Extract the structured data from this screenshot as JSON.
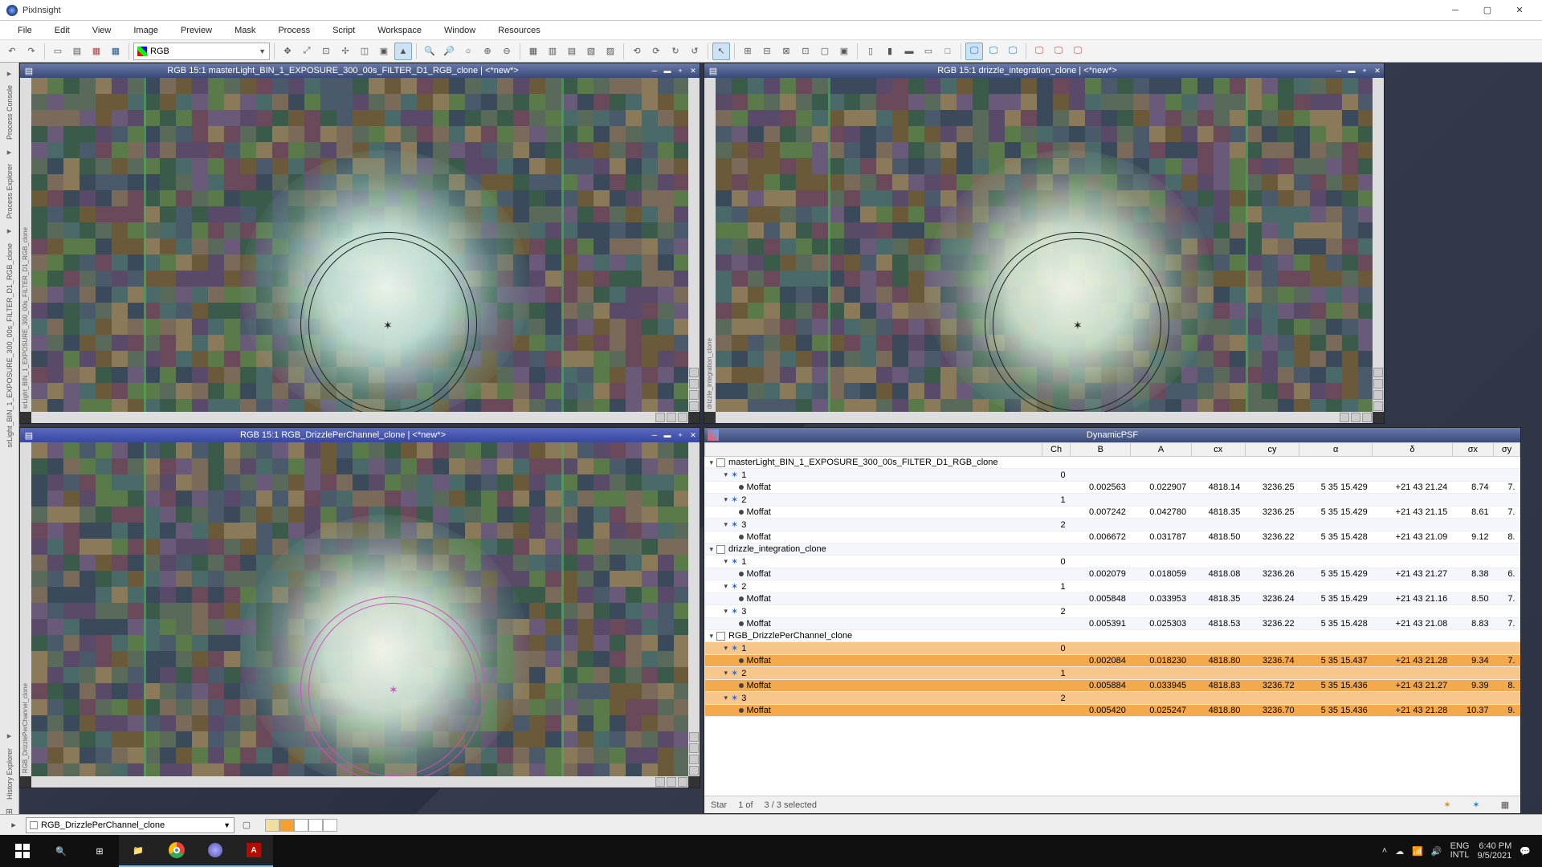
{
  "app": {
    "title": "PixInsight"
  },
  "menu": [
    "File",
    "Edit",
    "View",
    "Image",
    "Preview",
    "Mask",
    "Process",
    "Script",
    "Workspace",
    "Window",
    "Resources"
  ],
  "toolbar_select": {
    "label": "RGB"
  },
  "left_rail": [
    "Process Console",
    "Process Explorer",
    "srLight_BIN_1_EXPOSURE_300_00s_FILTER_D1_RGB_clone",
    "History Explorer"
  ],
  "windows": {
    "tl": {
      "title": "RGB 15:1 masterLight_BIN_1_EXPOSURE_300_00s_FILTER_D1_RGB_clone | <*new*>",
      "vlabel": "srLight_BIN_1_EXPOSURE_300_00s_FILTER_D1_RGB_clone"
    },
    "tr": {
      "title": "RGB 15:1 drizzle_integration_clone | <*new*>",
      "vlabel": "drizzle_integration_clone"
    },
    "bl": {
      "title": "RGB 15:1 RGB_DrizzlePerChannel_clone | <*new*>",
      "vlabel": "RGB_DrizzlePerChannel_clone"
    },
    "psf": {
      "title": "DynamicPSF"
    }
  },
  "psf": {
    "columns": [
      "",
      "Ch",
      "B",
      "A",
      "cx",
      "cy",
      "α",
      "δ",
      "σx",
      "σy"
    ],
    "groups": [
      {
        "name": "masterLight_BIN_1_EXPOSURE_300_00s_FILTER_D1_RGB_clone",
        "stars": [
          {
            "n": "1",
            "ch": "0",
            "rows": [
              {
                "f": "Moffat",
                "B": "0.002563",
                "A": "0.022907",
                "cx": "4818.14",
                "cy": "3236.25",
                "a": "5 35 15.429",
                "d": "+21 43 21.24",
                "sx": "8.74",
                "sy": "7."
              }
            ]
          },
          {
            "n": "2",
            "ch": "1",
            "rows": [
              {
                "f": "Moffat",
                "B": "0.007242",
                "A": "0.042780",
                "cx": "4818.35",
                "cy": "3236.25",
                "a": "5 35 15.429",
                "d": "+21 43 21.15",
                "sx": "8.61",
                "sy": "7."
              }
            ]
          },
          {
            "n": "3",
            "ch": "2",
            "rows": [
              {
                "f": "Moffat",
                "B": "0.006672",
                "A": "0.031787",
                "cx": "4818.50",
                "cy": "3236.22",
                "a": "5 35 15.428",
                "d": "+21 43 21.09",
                "sx": "9.12",
                "sy": "8."
              }
            ]
          }
        ]
      },
      {
        "name": "drizzle_integration_clone",
        "stars": [
          {
            "n": "1",
            "ch": "0",
            "rows": [
              {
                "f": "Moffat",
                "B": "0.002079",
                "A": "0.018059",
                "cx": "4818.08",
                "cy": "3236.26",
                "a": "5 35 15.429",
                "d": "+21 43 21.27",
                "sx": "8.38",
                "sy": "6."
              }
            ]
          },
          {
            "n": "2",
            "ch": "1",
            "rows": [
              {
                "f": "Moffat",
                "B": "0.005848",
                "A": "0.033953",
                "cx": "4818.35",
                "cy": "3236.24",
                "a": "5 35 15.429",
                "d": "+21 43 21.16",
                "sx": "8.50",
                "sy": "7."
              }
            ]
          },
          {
            "n": "3",
            "ch": "2",
            "rows": [
              {
                "f": "Moffat",
                "B": "0.005391",
                "A": "0.025303",
                "cx": "4818.53",
                "cy": "3236.22",
                "a": "5 35 15.428",
                "d": "+21 43 21.08",
                "sx": "8.83",
                "sy": "7."
              }
            ]
          }
        ]
      },
      {
        "name": "RGB_DrizzlePerChannel_clone",
        "selected": true,
        "stars": [
          {
            "n": "1",
            "ch": "0",
            "sel": true,
            "rows": [
              {
                "f": "Moffat",
                "B": "0.002084",
                "A": "0.018230",
                "cx": "4818.80",
                "cy": "3236.74",
                "a": "5 35 15.437",
                "d": "+21 43 21.28",
                "sx": "9.34",
                "sy": "7."
              }
            ]
          },
          {
            "n": "2",
            "ch": "1",
            "sel": true,
            "rows": [
              {
                "f": "Moffat",
                "B": "0.005884",
                "A": "0.033945",
                "cx": "4818.83",
                "cy": "3236.72",
                "a": "5 35 15.436",
                "d": "+21 43 21.27",
                "sx": "9.39",
                "sy": "8."
              }
            ]
          },
          {
            "n": "3",
            "ch": "2",
            "sel": true,
            "rows": [
              {
                "f": "Moffat",
                "B": "0.005420",
                "A": "0.025247",
                "cx": "4818.80",
                "cy": "3236.70",
                "a": "5 35 15.436",
                "d": "+21 43 21.28",
                "sx": "10.37",
                "sy": "9."
              }
            ]
          }
        ]
      }
    ],
    "status": {
      "label": "Star",
      "count": "1 of",
      "sel": "3 / 3 selected"
    }
  },
  "statusbar": {
    "image": "RGB_DrizzlePerChannel_clone"
  },
  "tray": {
    "lang1": "ENG",
    "lang2": "INTL",
    "time": "6:40 PM",
    "date": "9/5/2021"
  }
}
